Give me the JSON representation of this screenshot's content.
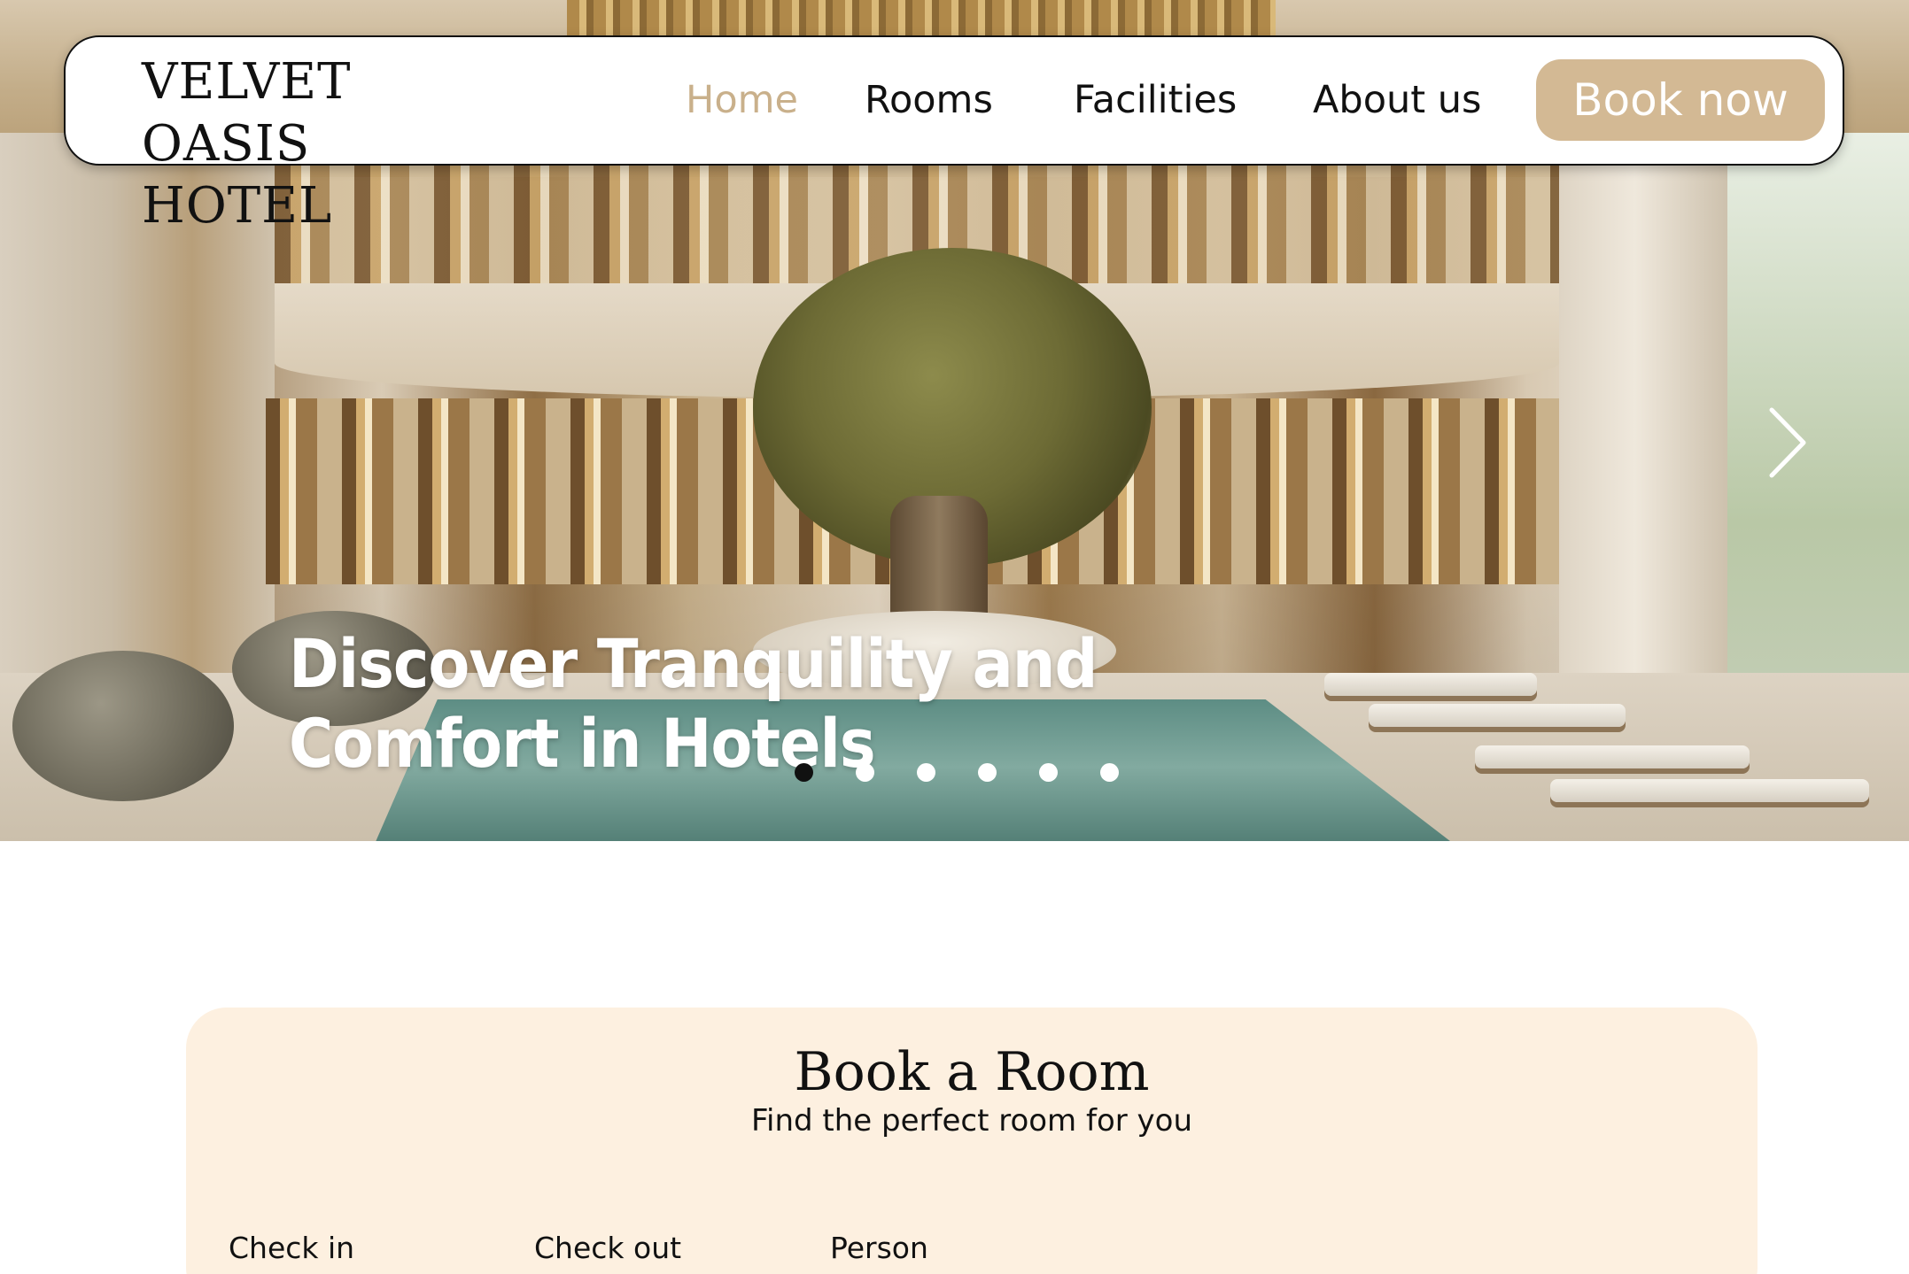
{
  "brand": {
    "name": "VELVET OASIS HOTEL",
    "line1": "VELVET OASIS",
    "line2": "HOTEL"
  },
  "nav": {
    "items": [
      {
        "label": "Home",
        "active": true
      },
      {
        "label": "Rooms",
        "active": false
      },
      {
        "label": "Facilities",
        "active": false
      },
      {
        "label": "About us",
        "active": false
      }
    ],
    "cta_label": "Book now"
  },
  "hero": {
    "title": "Discover Tranquility and Comfort in Hotels",
    "next_icon": "chevron-right-icon",
    "slide_count": 6,
    "active_slide": 1
  },
  "booking": {
    "title": "Book a Room",
    "subtitle": "Find the perfect room for you",
    "fields": [
      {
        "label": "Check in"
      },
      {
        "label": "Check out"
      },
      {
        "label": "Person"
      }
    ]
  },
  "colors": {
    "accent": "#d3b994",
    "active_nav": "#c9b08b",
    "card_background": "#fdf0e0",
    "text": "#111111"
  }
}
